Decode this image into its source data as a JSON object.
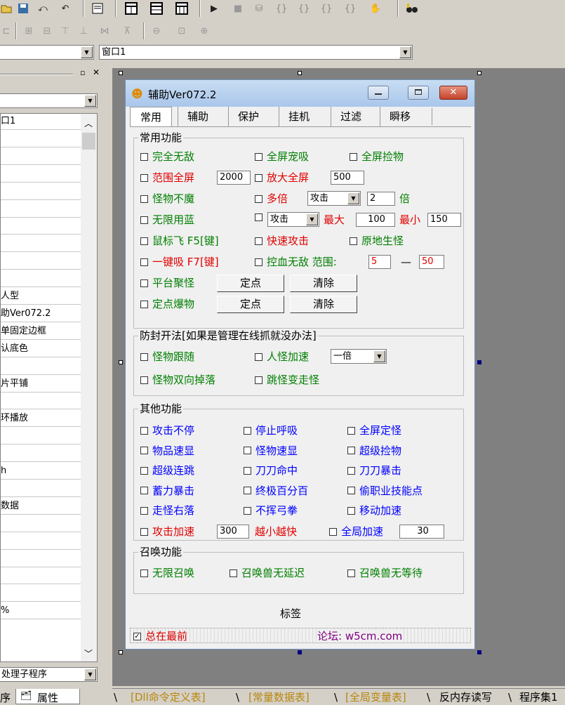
{
  "window_combo": {
    "value": "窗口1"
  },
  "left_panel": {
    "top_combo_arrow": "▼",
    "rows": [
      "口1",
      "",
      "",
      "",
      "",
      "",
      "",
      "",
      "",
      "",
      "人型",
      "助Ver072.2",
      "单固定边框",
      "认底色",
      "",
      "片平铺",
      "",
      "环播放",
      "",
      "",
      "h",
      "",
      "数据",
      "",
      "",
      "",
      "",
      "",
      "%"
    ],
    "bottom_combo": "处理子程序",
    "tab_left": "序",
    "tab_props": "属性"
  },
  "dialog": {
    "title": "辅助Ver072.2",
    "tabs": [
      "常用",
      "辅助",
      "保护",
      "挂机",
      "过滤",
      "瞬移"
    ],
    "group_common": {
      "label": "常用功能",
      "wudi": "完全无敌",
      "xi": "全屏宠吸",
      "jianwu": "全屏捡物",
      "fanwei": "范围全屏",
      "fanwei_val": "2000",
      "fangda": "放大全屏",
      "fangda_val": "500",
      "bumo": "怪物不魔",
      "duobei": "多倍",
      "duobei_combo": "攻击",
      "duobei_val": "2",
      "bei": "倍",
      "wuxian_lan": "无限用蓝",
      "combo2": "攻击",
      "max_label": "最大",
      "max_val": "100",
      "min_label": "最小",
      "min_val": "150",
      "shubiao": "鼠标飞 F5[键]",
      "kuaisu": "快速攻击",
      "yuandi": "原地生怪",
      "yijian": "一键吸 F7[键]",
      "kongxue": "控血无敌 范围:",
      "kongxue_val1": "5",
      "dash": "—",
      "kongxue_val2": "50",
      "pingtai": "平台聚怪",
      "dingdian_bao": "定点爆物",
      "btn_dingdian": "定点",
      "btn_qingchu": "清除"
    },
    "group_anti": {
      "label": "防封开法[如果是管理在线抓就没办法]",
      "gensui": "怪物跟随",
      "renguai": "人怪加速",
      "speed_combo": "一倍",
      "shuangxiang": "怪物双向掉落",
      "tiaoguai": "跳怪变走怪"
    },
    "group_other": {
      "label": "其他功能",
      "items": [
        [
          "攻击不停",
          "停止呼吸",
          "全屏定怪"
        ],
        [
          "物品速显",
          "怪物速显",
          "超级捡物"
        ],
        [
          "超级连跳",
          "刀刀命中",
          "刀刀暴击"
        ],
        [
          "蓄力暴击",
          "终极百分百",
          "偷职业技能点"
        ],
        [
          "走怪右落",
          "不挥弓拳",
          "移动加速"
        ]
      ],
      "gongji_jiasu": "攻击加速",
      "gongji_val": "300",
      "yuexiao": "越小越快",
      "quanju": "全局加速",
      "quanju_val": "30"
    },
    "group_summon": {
      "label": "召唤功能",
      "s1": "无限召唤",
      "s2": "召唤兽无延迟",
      "s3": "召唤兽无等待"
    },
    "label_tag": "标签",
    "topmost": "总在最前",
    "forum": "论坛: w5cm.com"
  },
  "bottom_tabs": [
    "[Dll命令定义表]",
    "[常量数据表]",
    "[全局变量表]",
    "反内存读写",
    "程序集1"
  ]
}
